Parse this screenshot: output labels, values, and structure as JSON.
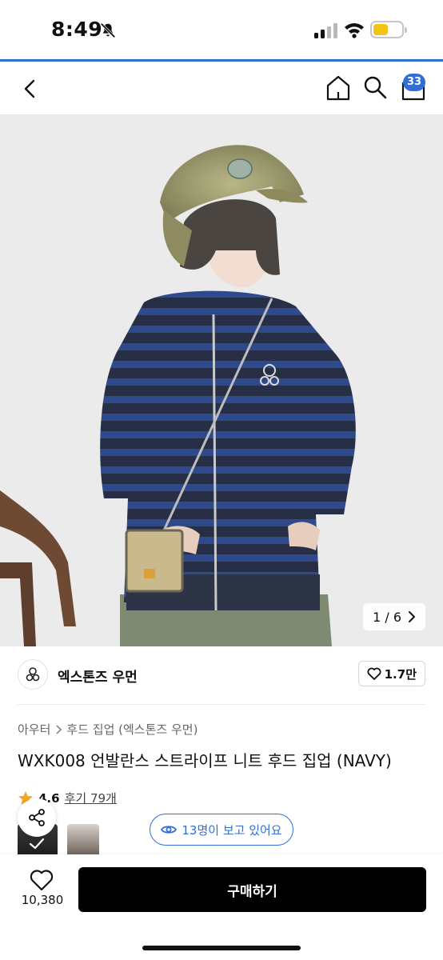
{
  "status_bar": {
    "time": "8:49"
  },
  "header": {
    "cart_badge": "33"
  },
  "gallery": {
    "counter_label": "1 / 6"
  },
  "brand": {
    "name": "엑스톤즈 우먼",
    "likes": "1.7만"
  },
  "breadcrumb": {
    "category": "아우터",
    "subcategory": "후드 집업 (엑스톤즈 우먼)"
  },
  "product": {
    "title": "WXK008 언발란스 스트라이프 니트 후드 집업 (NAVY)"
  },
  "rating": {
    "value": "4.6",
    "reviews_label": "후기 79개"
  },
  "viewers": {
    "label": "13명이 보고 있어요"
  },
  "bottom_bar": {
    "wish_count": "10,380",
    "buy_label": "구매하기"
  },
  "colors": {
    "accent": "#2f6fd6",
    "buy_button": "#000000",
    "star": "#f5a623",
    "battery": "#f3c316"
  },
  "icons": [
    "bell-slash-icon",
    "signal-icon",
    "wifi-icon",
    "battery-icon",
    "back-icon",
    "home-icon",
    "search-icon",
    "shopping-bag-icon",
    "chevron-right-icon",
    "heart-icon",
    "star-icon",
    "share-icon",
    "eye-icon",
    "check-icon"
  ]
}
